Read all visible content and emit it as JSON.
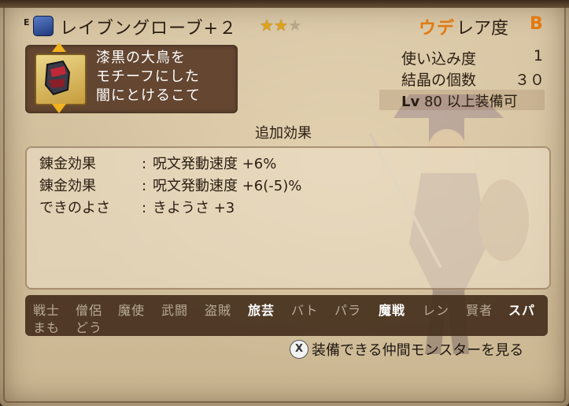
{
  "item": {
    "equip_marker": "E",
    "name": "レイブングローブ+２",
    "stars_filled": 2,
    "stars_total": 3,
    "description_lines": [
      "漆黒の大鳥を",
      "モチーフにした",
      "闇にとけるこて"
    ]
  },
  "header": {
    "ude_label": "ウデ",
    "rarity_label": "レア度",
    "rarity_value": "B"
  },
  "stats": {
    "usage_label": "使い込み度",
    "usage_value": "1",
    "crystal_label": "結晶の個数",
    "crystal_value": "３０",
    "lv_tag": "Lv",
    "lv_value": "80",
    "lv_suffix": "以上装備可"
  },
  "extra_effects": {
    "title": "追加効果",
    "rows": [
      {
        "key": "錬金効果",
        "value": "呪文発動速度 +6%"
      },
      {
        "key": "錬金効果",
        "value": "呪文発動速度 +6(-5)%"
      },
      {
        "key": "できのよさ",
        "value": "きようさ +3"
      }
    ]
  },
  "jobs": [
    {
      "label": "戦士",
      "active": false
    },
    {
      "label": "僧侶",
      "active": false
    },
    {
      "label": "魔使",
      "active": false
    },
    {
      "label": "武闘",
      "active": false
    },
    {
      "label": "盗賊",
      "active": false
    },
    {
      "label": "旅芸",
      "active": true
    },
    {
      "label": "バト",
      "active": false
    },
    {
      "label": "パラ",
      "active": false
    },
    {
      "label": "魔戦",
      "active": true
    },
    {
      "label": "レン",
      "active": false
    },
    {
      "label": "賢者",
      "active": false
    },
    {
      "label": "スパ",
      "active": true
    },
    {
      "label": "まも",
      "active": false
    },
    {
      "label": "どう",
      "active": false
    }
  ],
  "prompt": {
    "button_glyph": "X",
    "text": "装備できる仲間モンスターを見る"
  },
  "icons": {
    "equipped_item_icon": "glove-icon",
    "portrait_icon": "gauntlet-icon",
    "scroll_up": "arrow-up-icon",
    "scroll_down": "arrow-down-icon"
  },
  "colors": {
    "accent_orange": "#e27a10",
    "star_gold": "#e0a21a",
    "dark_panel": "#5a3c28",
    "parchment": "#d2bf9c"
  }
}
